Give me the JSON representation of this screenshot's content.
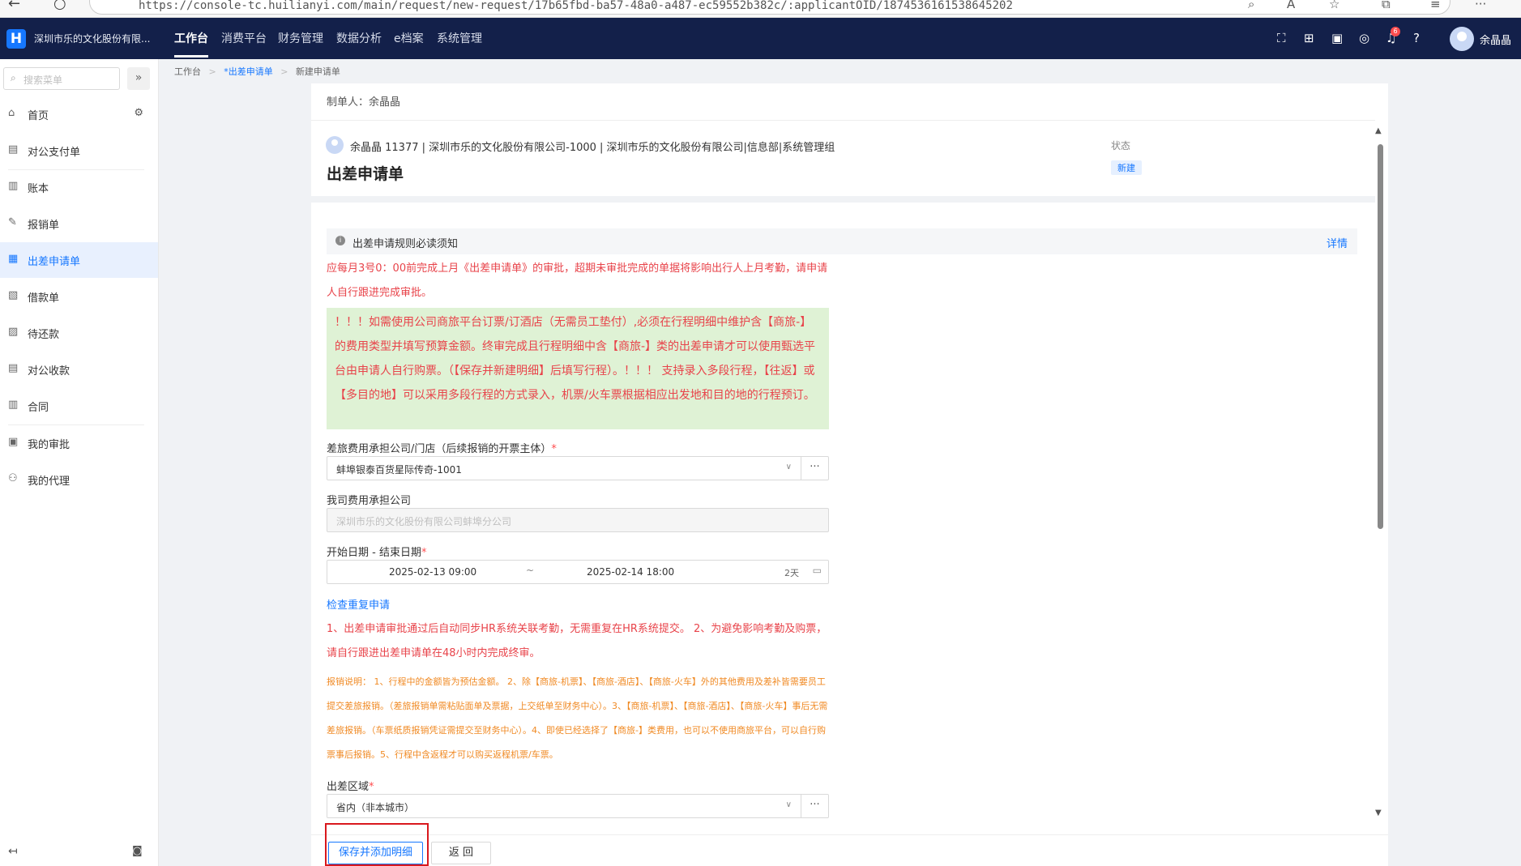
{
  "browser": {
    "url": "https://console-tc.huilianyi.com/main/request/new-request/17b65fbd-ba57-48a0-a487-ec59552b382c/:applicantOID/1874536161538645202"
  },
  "topnav": {
    "logo": "H",
    "company": "深圳市乐的文化股份有限...",
    "menus": [
      "工作台",
      "消费平台",
      "财务管理",
      "数据分析",
      "e档案",
      "系统管理"
    ],
    "notification_count": "6",
    "user_name": "余晶晶"
  },
  "sidebar": {
    "search_placeholder": "搜索菜单",
    "collapse_icon": "»",
    "items": [
      "首页",
      "对公支付单",
      "账本",
      "报销单",
      "出差申请单",
      "借款单",
      "待还款",
      "对公收款",
      "合同",
      "我的审批",
      "我的代理"
    ],
    "active": "出差申请单"
  },
  "breadcrumb": [
    "工作台",
    "*出差申请单",
    "新建申请单"
  ],
  "form": {
    "maker": "制单人：余晶晶",
    "user_info": "余晶晶 11377 | 深圳市乐的文化股份有限公司-1000 | 深圳市乐的文化股份有限公司|信息部|系统管理组",
    "title": "出差申请单",
    "status_label": "状态",
    "status_value": "新建",
    "notice_title": "出差申请规则必读须知",
    "notice_detail": "详情",
    "rule_text": "应每月3号0：00前完成上月《出差申请单》的审批，超期未审批完成的单据将影响出行人上月考勤，请申请人自行跟进完成审批。",
    "green_notice": "！！！如需使用公司商旅平台订票/订酒店（无需员工垫付）,必须在行程明细中维护含【商旅-】的费用类型并填写预算金额。终审完成且行程明细中含【商旅-】类的出差申请才可以使用甄选平台由申请人自行购票。（【保存并新建明细】后填写行程）。！！！ 支持录入多段行程，【往返】或【多目的地】可以采用多段行程的方式录入，机票/火车票根据相应出发地和目的地的行程预订。",
    "field_company_label": "差旅费用承担公司/门店（后续报销的开票主体）",
    "field_company_value": "蚌埠银泰百货星际传奇-1001",
    "field_our_company_label": "我司费用承担公司",
    "field_our_company_value": "深圳市乐的文化股份有限公司蚌埠分公司",
    "field_date_label": "开始日期 - 结束日期",
    "date_start": "2025-02-13 09:00",
    "date_tilde": "~",
    "date_end": "2025-02-14 18:00",
    "date_days": "2天",
    "check_link": "检查重复申请",
    "hr_text": "1、出差申请审批通过后自动同步HR系统关联考勤，无需重复在HR系统提交。 2、为避免影响考勤及购票，请自行跟进出差申请单在48小时内完成终审。",
    "reimburse_text": "报销说明： 1、行程中的金额皆为预估金额。 2、除【商旅-机票】、【商旅-酒店】、【商旅-火车】外的其他费用及差补皆需要员工提交差旅报销。（差旅报销单需粘贴面单及票据，上交纸单至财务中心）。3、【商旅-机票】、【商旅-酒店】、【商旅-火车】事后无需差旅报销。（车票纸质报销凭证需提交至财务中心）。4、即使已经选择了【商旅-】类费用，也可以不使用商旅平台，可以自行购票事后报销。5、行程中含返程才可以购买返程机票/车票。",
    "field_region_label": "出差区域",
    "field_region_value": "省内（非本城市）",
    "required_mark": "*",
    "more": "···"
  },
  "footer": {
    "save_label": "保存并添加明细",
    "back_label": "返 回"
  },
  "colors": {
    "nav_bg": "#13204a",
    "accent": "#1677ff",
    "warning_red": "#e8434a",
    "green_box": "#dff2d5",
    "orange": "#f08a24",
    "highlight": "#d9181d"
  }
}
